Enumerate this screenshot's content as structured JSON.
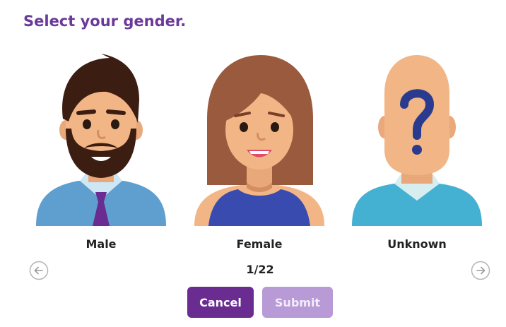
{
  "title": "Select your gender.",
  "options": [
    {
      "label": "Male"
    },
    {
      "label": "Female"
    },
    {
      "label": "Unknown"
    }
  ],
  "pagination": {
    "counter": "1/22",
    "prev_icon": "arrow-left-circle-icon",
    "next_icon": "arrow-right-circle-icon"
  },
  "buttons": {
    "cancel": "Cancel",
    "submit": "Submit"
  },
  "colors": {
    "title": "#6a3a9a",
    "cancel_bg": "#6a2c91",
    "submit_bg_disabled": "#b79ad6"
  }
}
